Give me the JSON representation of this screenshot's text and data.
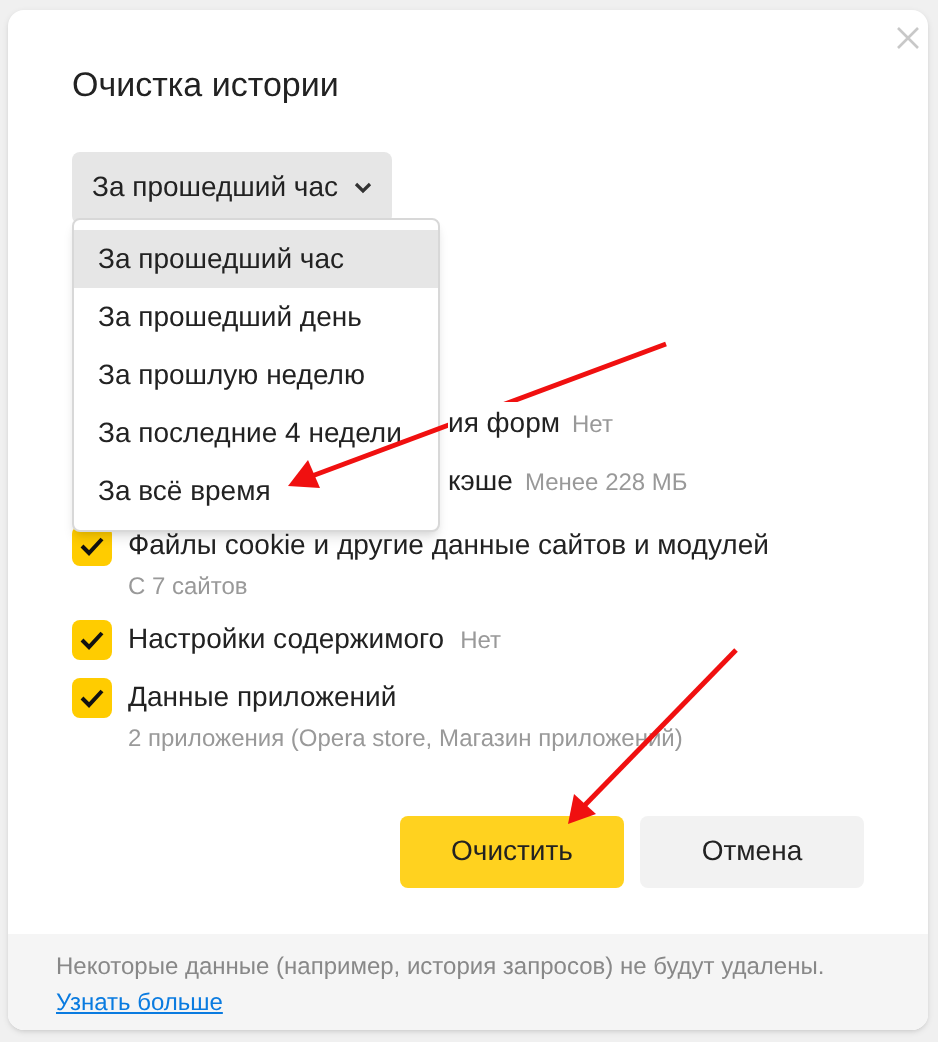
{
  "dialog": {
    "title": "Очистка истории",
    "period_select": {
      "value": "За прошедший час"
    },
    "period_menu": [
      {
        "label": "За прошедший час",
        "selected": true
      },
      {
        "label": "За прошедший день",
        "selected": false
      },
      {
        "label": "За прошлую неделю",
        "selected": false
      },
      {
        "label": "За последние 4 недели",
        "selected": false
      },
      {
        "label": "За всё время",
        "selected": false
      }
    ],
    "items": [
      {
        "kind": "partial",
        "label": "ия форм",
        "detail": "Нет"
      },
      {
        "kind": "partial",
        "label": "кэше",
        "detail": "Менее 228 МБ"
      },
      {
        "kind": "checkbox",
        "label": "Файлы cookie и другие данные сайтов и модулей",
        "checked": true,
        "subtitle": "С 7 сайтов"
      },
      {
        "kind": "checkbox",
        "label": "Настройки содержимого",
        "detail": "Нет",
        "checked": true
      },
      {
        "kind": "checkbox",
        "label": "Данные приложений",
        "checked": true,
        "subtitle": "2 приложения (Opera store, Магазин приложений)"
      }
    ],
    "buttons": [
      {
        "label": "Очистить",
        "primary": true
      },
      {
        "label": "Отмена",
        "primary": false
      }
    ],
    "footer": {
      "note": "Некоторые данные (например, история запросов) не будут удалены.",
      "link": "Узнать больше"
    }
  }
}
